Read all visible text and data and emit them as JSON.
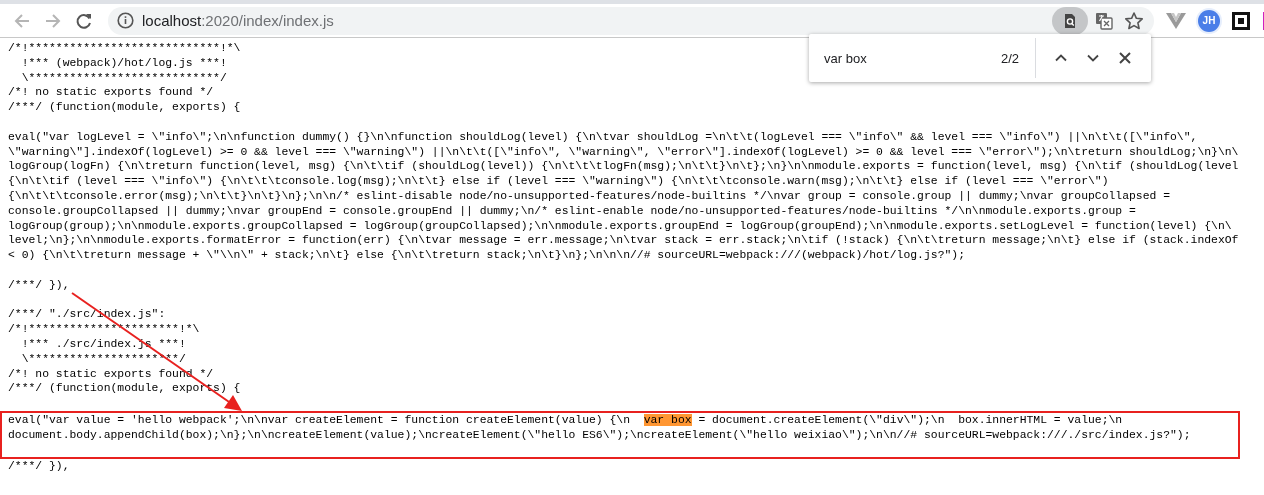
{
  "toolbar": {
    "address": {
      "host": "localhost",
      "path": ":2020/index/index.js"
    },
    "extension_badge": "JH"
  },
  "find_bar": {
    "query": "var box",
    "count": "2/2"
  },
  "code": {
    "blocks": [
      {
        "framed": false,
        "lines": [
          {
            "kind": "text",
            "text": "/*!****************************!*\\"
          },
          {
            "kind": "text",
            "text": "  !*** (webpack)/hot/log.js ***!"
          },
          {
            "kind": "text",
            "text": "  \\****************************/"
          },
          {
            "kind": "text",
            "text": "/*! no static exports found */"
          },
          {
            "kind": "text",
            "text": "/***/ (function(module, exports) {"
          },
          {
            "kind": "blank"
          },
          {
            "kind": "text",
            "text": "eval(\"var logLevel = \\\"info\\\";\\n\\nfunction dummy() {}\\n\\nfunction shouldLog(level) {\\n\\tvar shouldLog =\\n\\t\\t(logLevel === \\\"info\\\" && level === \\\"info\\\") ||\\n\\t\\t([\\\"info\\\","
          },
          {
            "kind": "text",
            "text": "\\\"warning\\\"].indexOf(logLevel) >= 0 && level === \\\"warning\\\") ||\\n\\t\\t([\\\"info\\\", \\\"warning\\\", \\\"error\\\"].indexOf(logLevel) >= 0 && level === \\\"error\\\");\\n\\treturn shouldLog;\\n}\\n\\"
          },
          {
            "kind": "text",
            "text": "logGroup(logFn) {\\n\\treturn function(level, msg) {\\n\\t\\tif (shouldLog(level)) {\\n\\t\\t\\tlogFn(msg);\\n\\t\\t}\\n\\t};\\n}\\n\\nmodule.exports = function(level, msg) {\\n\\tif (shouldLog(level"
          },
          {
            "kind": "text",
            "text": "{\\n\\t\\tif (level === \\\"info\\\") {\\n\\t\\t\\tconsole.log(msg);\\n\\t\\t} else if (level === \\\"warning\\\") {\\n\\t\\t\\tconsole.warn(msg);\\n\\t\\t} else if (level === \\\"error\\\")"
          },
          {
            "kind": "text",
            "text": "{\\n\\t\\t\\tconsole.error(msg);\\n\\t\\t}\\n\\t}\\n};\\n\\n/* eslint-disable node/no-unsupported-features/node-builtins */\\nvar group = console.group || dummy;\\nvar groupCollapsed ="
          },
          {
            "kind": "text",
            "text": "console.groupCollapsed || dummy;\\nvar groupEnd = console.groupEnd || dummy;\\n/* eslint-enable node/no-unsupported-features/node-builtins */\\n\\nmodule.exports.group ="
          },
          {
            "kind": "text",
            "text": "logGroup(group);\\n\\nmodule.exports.groupCollapsed = logGroup(groupCollapsed);\\n\\nmodule.exports.groupEnd = logGroup(groupEnd);\\n\\nmodule.exports.setLogLevel = function(level) {\\n\\"
          },
          {
            "kind": "text",
            "text": "level;\\n};\\n\\nmodule.exports.formatError = function(err) {\\n\\tvar message = err.message;\\n\\tvar stack = err.stack;\\n\\tif (!stack) {\\n\\t\\treturn message;\\n\\t} else if (stack.indexOf"
          },
          {
            "kind": "text",
            "text": "< 0) {\\n\\t\\treturn message + \\\"\\\\n\\\" + stack;\\n\\t} else {\\n\\t\\treturn stack;\\n\\t}\\n};\\n\\n\\n//# sourceURL=webpack:///(webpack)/hot/log.js?\");"
          },
          {
            "kind": "blank"
          },
          {
            "kind": "text",
            "text": "/***/ }),"
          },
          {
            "kind": "blank"
          },
          {
            "kind": "text",
            "text": "/***/ \"./src/index.js\":"
          },
          {
            "kind": "text",
            "text": "/*!**********************!*\\"
          },
          {
            "kind": "text",
            "text": "  !*** ./src/index.js ***!"
          },
          {
            "kind": "text",
            "text": "  \\**********************/"
          },
          {
            "kind": "text",
            "text": "/*! no static exports found */"
          },
          {
            "kind": "text",
            "text": "/***/ (function(module, exports) {"
          },
          {
            "kind": "blank"
          }
        ]
      },
      {
        "framed": true,
        "lines": [
          {
            "kind": "segments",
            "segments": [
              {
                "text": "eval(\"var value = 'hello webpack';\\n\\nvar createElement = function createElement(value) {\\n  ",
                "highlighted": false
              },
              {
                "text": "var box",
                "highlighted": true
              },
              {
                "text": " = document.createElement(\\\"div\\\");\\n  box.innerHTML = value;\\n",
                "highlighted": false
              }
            ]
          },
          {
            "kind": "text",
            "text": "document.body.appendChild(box);\\n};\\n\\ncreateElement(value);\\ncreateElement(\\\"hello ES6\\\");\\ncreateElement(\\\"hello weixiao\\\");\\n\\n//# sourceURL=webpack:///./src/index.js?\");"
          },
          {
            "kind": "blank"
          }
        ]
      },
      {
        "framed": false,
        "lines": [
          {
            "kind": "text",
            "text": "/***/ }),"
          }
        ]
      }
    ]
  }
}
